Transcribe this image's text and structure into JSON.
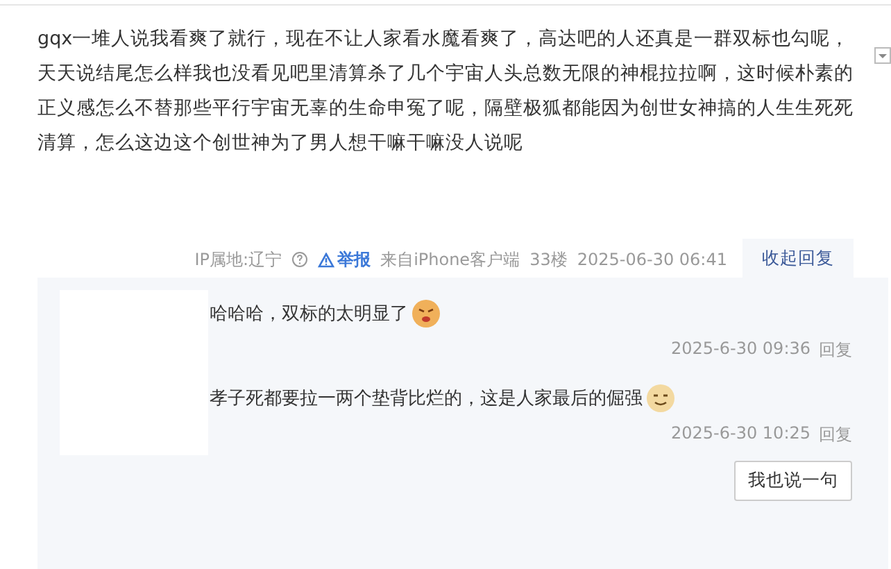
{
  "post": {
    "text": "gqx一堆人说我看爽了就行，现在不让人家看水魔看爽了，高达吧的人还真是一群双标也勾呢，天天说结尾怎么样我也没看见吧里清算杀了几个宇宙人头总数无限的神棍拉拉啊，这时候朴素的正义感怎么不替那些平行宇宙无辜的生命申冤了呢，隔壁极狐都能因为创世女神搞的人生生死死清算，怎么这边这个创世神为了男人想干嘛干嘛没人说呢"
  },
  "meta": {
    "ip": "IP属地:辽宁",
    "report": "举报",
    "source": "来自iPhone客户端",
    "floor": "33楼",
    "time": "2025-06-30 06:41",
    "toggle": "收起回复"
  },
  "replies": [
    {
      "text": "哈哈哈，双标的太明显了",
      "time": "2025-6-30 09:36",
      "reply": "回复"
    },
    {
      "text": "孝子死都要拉一两个垫背比烂的，这是人家最后的倔强",
      "time": "2025-6-30 10:25",
      "reply": "回复"
    }
  ],
  "say_button": "我也说一句"
}
